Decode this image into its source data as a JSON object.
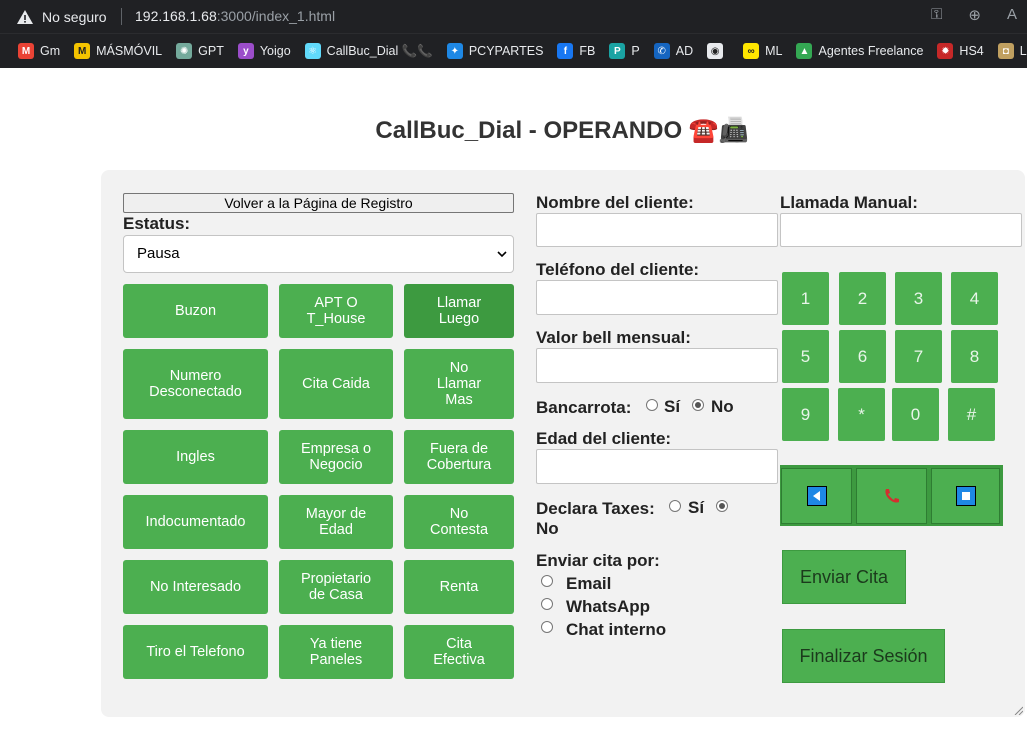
{
  "browser": {
    "security_label": "No seguro",
    "url_host": "192.168.1.68",
    "url_path": ":3000/index_1.html",
    "toolbar_icons": [
      "key-icon",
      "zoom-icon",
      "text-size-icon"
    ]
  },
  "bookmarks": [
    {
      "label": "Gm",
      "color": "#ea4335",
      "glyph": "M"
    },
    {
      "label": "MÁSMÓVIL",
      "color": "#f5c400",
      "glyph": "M"
    },
    {
      "label": "GPT",
      "color": "#74aa9c",
      "glyph": "✺"
    },
    {
      "label": "Yoigo",
      "color": "#9b4dca",
      "glyph": "y"
    },
    {
      "label": "CallBuc_Dial 📞📞",
      "color": "#61dafb",
      "glyph": "⚛"
    },
    {
      "label": "PCYPARTES",
      "color": "#1e88e5",
      "glyph": "✦"
    },
    {
      "label": "FB",
      "color": "#1877f2",
      "glyph": "f"
    },
    {
      "label": "P",
      "color": "#1aa3a3",
      "glyph": "P"
    },
    {
      "label": "AD",
      "color": "#1565c0",
      "glyph": "✆"
    },
    {
      "label": "",
      "color": "#e8eaed",
      "glyph": "◉"
    },
    {
      "label": "ML",
      "color": "#ffe600",
      "glyph": "∞"
    },
    {
      "label": "Agentes Freelance",
      "color": "#34a853",
      "glyph": "▲"
    },
    {
      "label": "HS4",
      "color": "#c62828",
      "glyph": "✹"
    },
    {
      "label": "L",
      "color": "#c0a060",
      "glyph": "◘"
    }
  ],
  "page": {
    "title": "CallBuc_Dial - OPERANDO",
    "title_emoji": "☎️📠",
    "back_button": "Volver a la Página de Registro",
    "status_label": "Estatus:",
    "status_value": "Pausa"
  },
  "outcomes": [
    [
      "Buzon",
      "APT O T_House",
      "Llamar Luego"
    ],
    [
      "Numero Desconectado",
      "Cita Caida",
      "No Llamar Mas"
    ],
    [
      "Ingles",
      "Empresa o Negocio",
      "Fuera de Cobertura"
    ],
    [
      "Indocumentado",
      "Mayor de Edad",
      "No Contesta"
    ],
    [
      "No Interesado",
      "Propietario de Casa",
      "Renta"
    ],
    [
      "Tiro el Telefono",
      "Ya tiene Paneles",
      "Cita Efectiva"
    ]
  ],
  "form": {
    "client_name_label": "Nombre del cliente:",
    "client_phone_label": "Teléfono del cliente:",
    "bell_label": "Valor bell mensual:",
    "bankruptcy_label": "Bancarrota:",
    "bankruptcy_yes": "Sí",
    "bankruptcy_no": "No",
    "bankruptcy_selected": "No",
    "age_label": "Edad del cliente:",
    "taxes_label": "Declara Taxes:",
    "taxes_yes": "Sí",
    "taxes_no": "No",
    "taxes_selected": "No",
    "send_label": "Enviar cita por:",
    "send_options": [
      "Email",
      "WhatsApp",
      "Chat interno"
    ]
  },
  "dialer": {
    "manual_label": "Llamada Manual:",
    "keys": [
      "1",
      "2",
      "3",
      "4",
      "5",
      "6",
      "7",
      "8",
      "9",
      "*",
      "0",
      "#"
    ],
    "controls": [
      "back-icon",
      "call-icon",
      "stop-icon"
    ],
    "send_button": "Enviar Cita",
    "finish_button": "Finalizar Sesión"
  },
  "colors": {
    "button_green": "#4caf50",
    "button_green_dark": "#3d9a40",
    "panel_bg": "#f2f2f2"
  }
}
